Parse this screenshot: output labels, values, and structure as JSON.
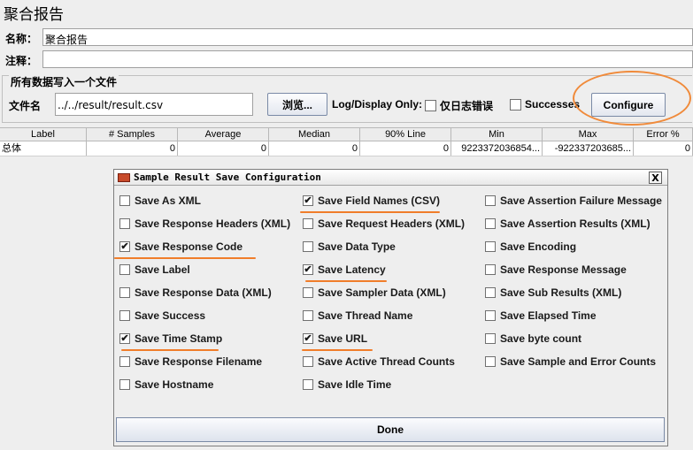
{
  "page": {
    "title": "聚合报告",
    "name_label": "名称：",
    "name_value": "聚合报告",
    "comment_label": "注释：",
    "comment_value": ""
  },
  "file_section": {
    "legend": "所有数据写入一个文件",
    "filename_label": "文件名",
    "filename_value": "../../result/result.csv",
    "browse_label": "浏览...",
    "log_display_label": "Log/Display Only:",
    "errors_only_label": "仅日志错误",
    "errors_only_checked": false,
    "successes_label": "Successes",
    "successes_checked": false,
    "configure_label": "Configure"
  },
  "table": {
    "headers": [
      "Label",
      "# Samples",
      "Average",
      "Median",
      "90% Line",
      "Min",
      "Max",
      "Error %"
    ],
    "rows": [
      [
        "总体",
        "0",
        "0",
        "0",
        "0",
        "9223372036854...",
        "-922337203685...",
        "0"
      ]
    ]
  },
  "dialog": {
    "title": "Sample Result Save Configuration",
    "close_label": "X",
    "options": [
      {
        "label": "Save As XML",
        "checked": false
      },
      {
        "label": "Save Field Names (CSV)",
        "checked": true
      },
      {
        "label": "Save Assertion Failure Message",
        "checked": false
      },
      {
        "label": "Save Response Headers (XML)",
        "checked": false
      },
      {
        "label": "Save Request Headers (XML)",
        "checked": false
      },
      {
        "label": "Save Assertion Results (XML)",
        "checked": false
      },
      {
        "label": "Save Response Code",
        "checked": true
      },
      {
        "label": "Save Data Type",
        "checked": false
      },
      {
        "label": "Save Encoding",
        "checked": false
      },
      {
        "label": "Save Label",
        "checked": false
      },
      {
        "label": "Save Latency",
        "checked": true
      },
      {
        "label": "Save Response Message",
        "checked": false
      },
      {
        "label": "Save Response Data (XML)",
        "checked": false
      },
      {
        "label": "Save Sampler Data (XML)",
        "checked": false
      },
      {
        "label": "Save Sub Results (XML)",
        "checked": false
      },
      {
        "label": "Save Success",
        "checked": false
      },
      {
        "label": "Save Thread Name",
        "checked": false
      },
      {
        "label": "Save Elapsed Time",
        "checked": false
      },
      {
        "label": "Save Time Stamp",
        "checked": true
      },
      {
        "label": "Save URL",
        "checked": true
      },
      {
        "label": "Save byte count",
        "checked": false
      },
      {
        "label": "Save Response Filename",
        "checked": false
      },
      {
        "label": "Save Active Thread Counts",
        "checked": false
      },
      {
        "label": "Save Sample and Error Counts",
        "checked": false
      },
      {
        "label": "Save Hostname",
        "checked": false
      },
      {
        "label": "Save Idle Time",
        "checked": false
      }
    ],
    "done_label": "Done"
  },
  "colors": {
    "annotation": "#f07d2a"
  }
}
